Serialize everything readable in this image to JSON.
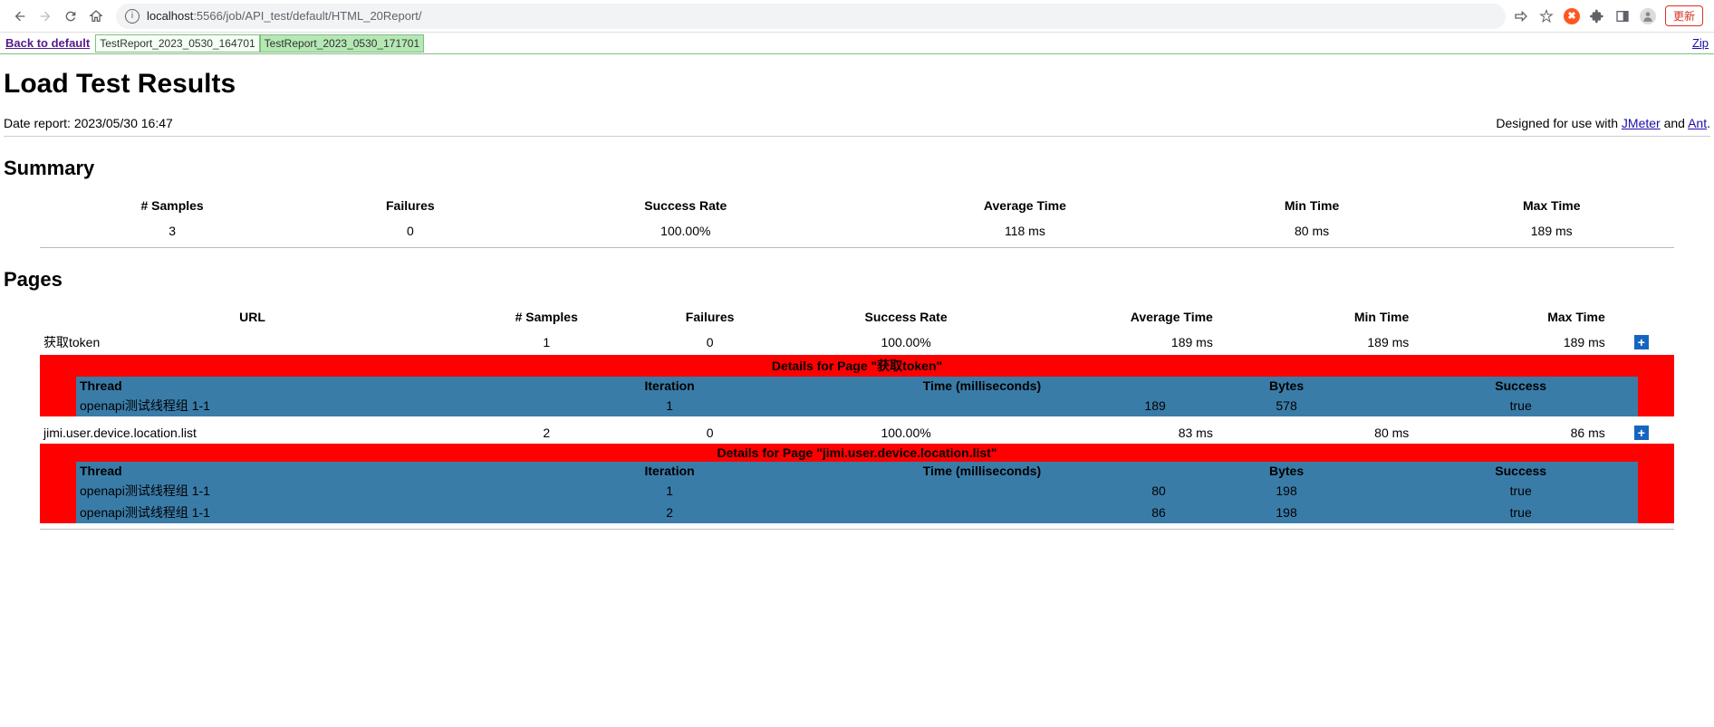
{
  "browser": {
    "url_host": "localhost",
    "url_port": ":5566",
    "url_path": "/job/API_test/default/HTML_20Report/",
    "update_label": "更新"
  },
  "topbar": {
    "back_link": "Back to default",
    "tabs": [
      "TestReport_2023_0530_164701",
      "TestReport_2023_0530_171701"
    ],
    "zip_link": "Zip"
  },
  "heading": "Load Test Results",
  "date_report": "Date report: 2023/05/30 16:47",
  "designed_prefix": "Designed for use with ",
  "designed_link1": "JMeter",
  "designed_and": " and ",
  "designed_link2": "Ant",
  "summary": {
    "title": "Summary",
    "headers": [
      "# Samples",
      "Failures",
      "Success Rate",
      "Average Time",
      "Min Time",
      "Max Time"
    ],
    "row": [
      "3",
      "0",
      "100.00%",
      "118 ms",
      "80 ms",
      "189 ms"
    ]
  },
  "pages": {
    "title": "Pages",
    "headers": [
      "URL",
      "# Samples",
      "Failures",
      "Success Rate",
      "Average Time",
      "Min Time",
      "Max Time"
    ],
    "rows": [
      {
        "url": "获取token",
        "samples": "1",
        "failures": "0",
        "success": "100.00%",
        "avg": "189 ms",
        "min": "189 ms",
        "max": "189 ms",
        "detail_title": "Details for Page \"获取token\"",
        "detail_headers": [
          "Thread",
          "Iteration",
          "Time (milliseconds)",
          "Bytes",
          "Success"
        ],
        "detail_rows": [
          {
            "thread": "openapi测试线程组 1-1",
            "iter": "1",
            "time": "189",
            "bytes": "578",
            "success": "true"
          }
        ]
      },
      {
        "url": "jimi.user.device.location.list",
        "samples": "2",
        "failures": "0",
        "success": "100.00%",
        "avg": "83 ms",
        "min": "80 ms",
        "max": "86 ms",
        "detail_title": "Details for Page \"jimi.user.device.location.list\"",
        "detail_headers": [
          "Thread",
          "Iteration",
          "Time (milliseconds)",
          "Bytes",
          "Success"
        ],
        "detail_rows": [
          {
            "thread": "openapi测试线程组 1-1",
            "iter": "1",
            "time": "80",
            "bytes": "198",
            "success": "true"
          },
          {
            "thread": "openapi测试线程组 1-1",
            "iter": "2",
            "time": "86",
            "bytes": "198",
            "success": "true"
          }
        ]
      }
    ]
  }
}
